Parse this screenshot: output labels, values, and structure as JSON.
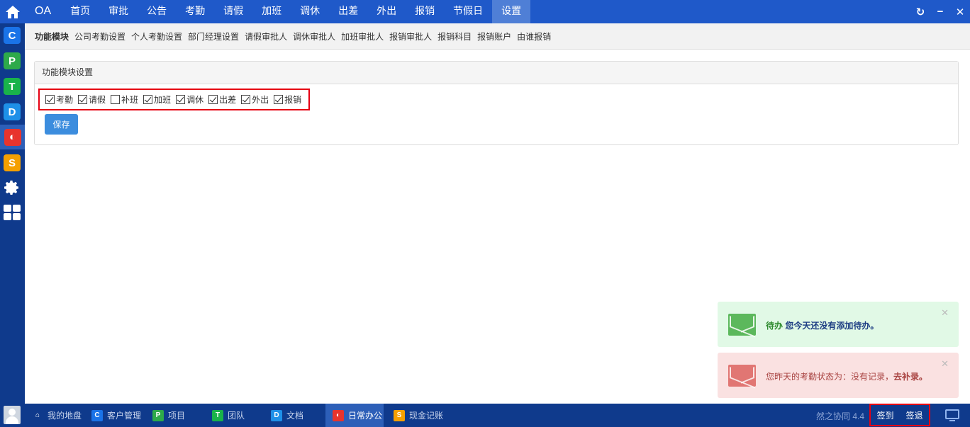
{
  "colors": {
    "primary": "#1f59c9",
    "rail": "#0f3a8c",
    "highlight_border": "#e60012",
    "button": "#3c8dde",
    "success_bg": "#e1f9e6",
    "danger_bg": "#fae1e1"
  },
  "topbar": {
    "brand": "OA",
    "nav": [
      "首页",
      "审批",
      "公告",
      "考勤",
      "请假",
      "加班",
      "调休",
      "出差",
      "外出",
      "报销",
      "节假日",
      "设置"
    ],
    "active": "设置",
    "window_icons": [
      "refresh-icon",
      "minimize-icon",
      "close-icon"
    ]
  },
  "rail": {
    "apps": [
      {
        "icon": "c-app-icon",
        "glyph": "C",
        "color": "#1a73e8"
      },
      {
        "icon": "p-app-icon",
        "glyph": "P",
        "color": "#2eaa4a"
      },
      {
        "icon": "t-app-icon",
        "glyph": "T",
        "color": "#19b34a"
      },
      {
        "icon": "d-app-icon",
        "glyph": "D",
        "color": "#1e90e8"
      },
      {
        "icon": "o-app-icon",
        "glyph": "◐",
        "color": "#e8342d"
      },
      {
        "icon": "s-app-icon",
        "glyph": "S",
        "color": "#f5a000"
      }
    ]
  },
  "submenu": {
    "items": [
      "功能模块",
      "公司考勤设置",
      "个人考勤设置",
      "部门经理设置",
      "请假审批人",
      "调休审批人",
      "加班审批人",
      "报销审批人",
      "报销科目",
      "报销账户",
      "由谁报销"
    ],
    "active": "功能模块"
  },
  "panel": {
    "title": "功能模块设置",
    "modules": [
      {
        "label": "考勤",
        "checked": true
      },
      {
        "label": "请假",
        "checked": true
      },
      {
        "label": "补班",
        "checked": false
      },
      {
        "label": "加班",
        "checked": true
      },
      {
        "label": "调休",
        "checked": true
      },
      {
        "label": "出差",
        "checked": true
      },
      {
        "label": "外出",
        "checked": true
      },
      {
        "label": "报销",
        "checked": true
      }
    ],
    "save_label": "保存"
  },
  "notifications": {
    "todo": {
      "tag": "待办",
      "text": "您今天还没有添加待办。"
    },
    "attendance": {
      "text": "您昨天的考勤状态为：没有记录，",
      "link": "去补录。"
    }
  },
  "taskbar": {
    "tasks": [
      {
        "label": "我的地盘",
        "glyph": "⌂",
        "color": "transparent"
      },
      {
        "label": "客户管理",
        "glyph": "C",
        "color": "#1a73e8"
      },
      {
        "label": "项目",
        "glyph": "P",
        "color": "#2eaa4a"
      },
      {
        "label": "团队",
        "glyph": "T",
        "color": "#19b34a"
      },
      {
        "label": "文档",
        "glyph": "D",
        "color": "#1e90e8"
      },
      {
        "label": "日常办公",
        "glyph": "◐",
        "color": "#e8342d"
      },
      {
        "label": "现金记账",
        "glyph": "S",
        "color": "#f5a000"
      }
    ],
    "active": "日常办公",
    "version": "然之协同 4.4",
    "sign_in": "签到",
    "sign_out": "签退"
  }
}
